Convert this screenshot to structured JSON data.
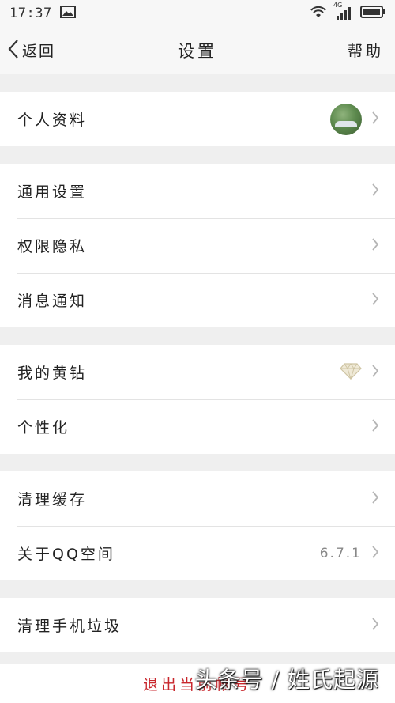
{
  "status_bar": {
    "time": "17:37",
    "network_label": "4G"
  },
  "nav": {
    "back_label": "返回",
    "title": "设置",
    "help_label": "帮助"
  },
  "groups": [
    {
      "rows": [
        {
          "label": "个人资料",
          "right": "avatar"
        }
      ]
    },
    {
      "rows": [
        {
          "label": "通用设置"
        },
        {
          "label": "权限隐私"
        },
        {
          "label": "消息通知"
        }
      ]
    },
    {
      "rows": [
        {
          "label": "我的黄钻",
          "right": "diamond-icon"
        },
        {
          "label": "个性化"
        }
      ]
    },
    {
      "rows": [
        {
          "label": "清理缓存"
        },
        {
          "label": "关于QQ空间",
          "value": "6.7.1"
        }
      ]
    },
    {
      "rows": [
        {
          "label": "清理手机垃圾"
        }
      ]
    }
  ],
  "logout_label": "退出当前帐号",
  "watermark": "头条号 / 姓氏起源",
  "colors": {
    "accent_red": "#c8262c",
    "background": "#efefef",
    "chevron": "#b5b5b5"
  }
}
